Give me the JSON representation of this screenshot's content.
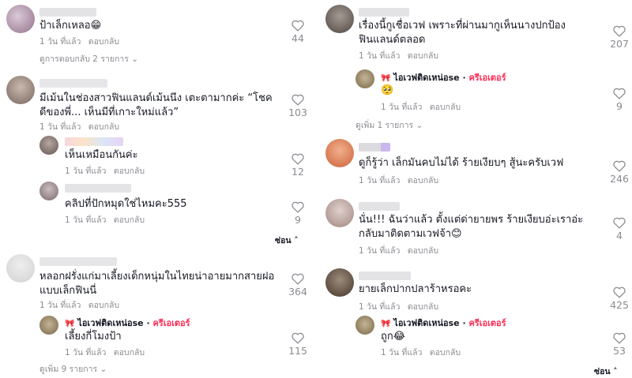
{
  "common": {
    "time": "1 วัน ที่แล้ว",
    "reply": "ตอบกลับ",
    "creator_label": "ครีเอเตอร์"
  },
  "left": {
    "c1": {
      "text": "ป้าเล็กเหลอ😁",
      "likes": "44",
      "more": "ดูการตอบกลับ 2 รายการ"
    },
    "c2": {
      "text": "มีเม้นในช่องสาวฟินแลนด์เม้นนึง เตะตามากค่ะ “โชคดีของพี่... เห็นมีที่เกาะใหม่แล้ว”",
      "likes": "103",
      "r1": {
        "text": "เห็นเหมือนกันค่ะ",
        "likes": "12"
      },
      "r2": {
        "text": "คลิปที่ปักหมุดใช่ไหมคะ555",
        "likes": "9"
      },
      "collapse": "ซ่อน"
    },
    "c3": {
      "text": "หลอกฝรั่งแก่มาเลี้ยงเด็กหนุ่มในไทยน่าอายมากสายฝอแบบเล็กฟินนี่",
      "likes": "364",
      "reply": {
        "name": "ไอเวฟติดเหน่อse",
        "text": "เลี้ยงกี่โมงป้า",
        "likes": "115"
      },
      "more": "ดูเพิ่ม 9 รายการ"
    }
  },
  "right": {
    "c1": {
      "text": "เรื่องนี้กูเชื่อเวฟ เพราะที่ผ่านมากูเห็นนางปกป้อง ฟินแลนด์ตลอด",
      "likes": "207",
      "reply": {
        "name": "ไอเวฟติดเหน่อse",
        "text": "🥺",
        "likes": "9"
      },
      "more": "ดูเพิ่ม 1 รายการ"
    },
    "c2": {
      "text": "ดูก็รู้ว่า เล็กมันคบไม่ได้ ร้ายเงียบๆ สู้นะครับเวฟ",
      "likes": "246"
    },
    "c3": {
      "text": "นั่น!!! ฉันว่าแล้ว ตั้งแต่ด่ายายพร ร้ายเงียบอ่ะเราอ่ะ กลับมาติดตามเวฟจ้า😊",
      "likes": "4"
    },
    "c4": {
      "text": "ยายเล็กปากปลาร้าหรอคะ",
      "likes": "425",
      "reply": {
        "name": "ไอเวฟติดเหน่อse",
        "text": "ถูก😂",
        "likes": "53"
      },
      "collapse": "ซ่อน"
    }
  },
  "colors": {
    "creator": "#fe2c55",
    "meta": "#8a8b91",
    "text": "#161823"
  }
}
